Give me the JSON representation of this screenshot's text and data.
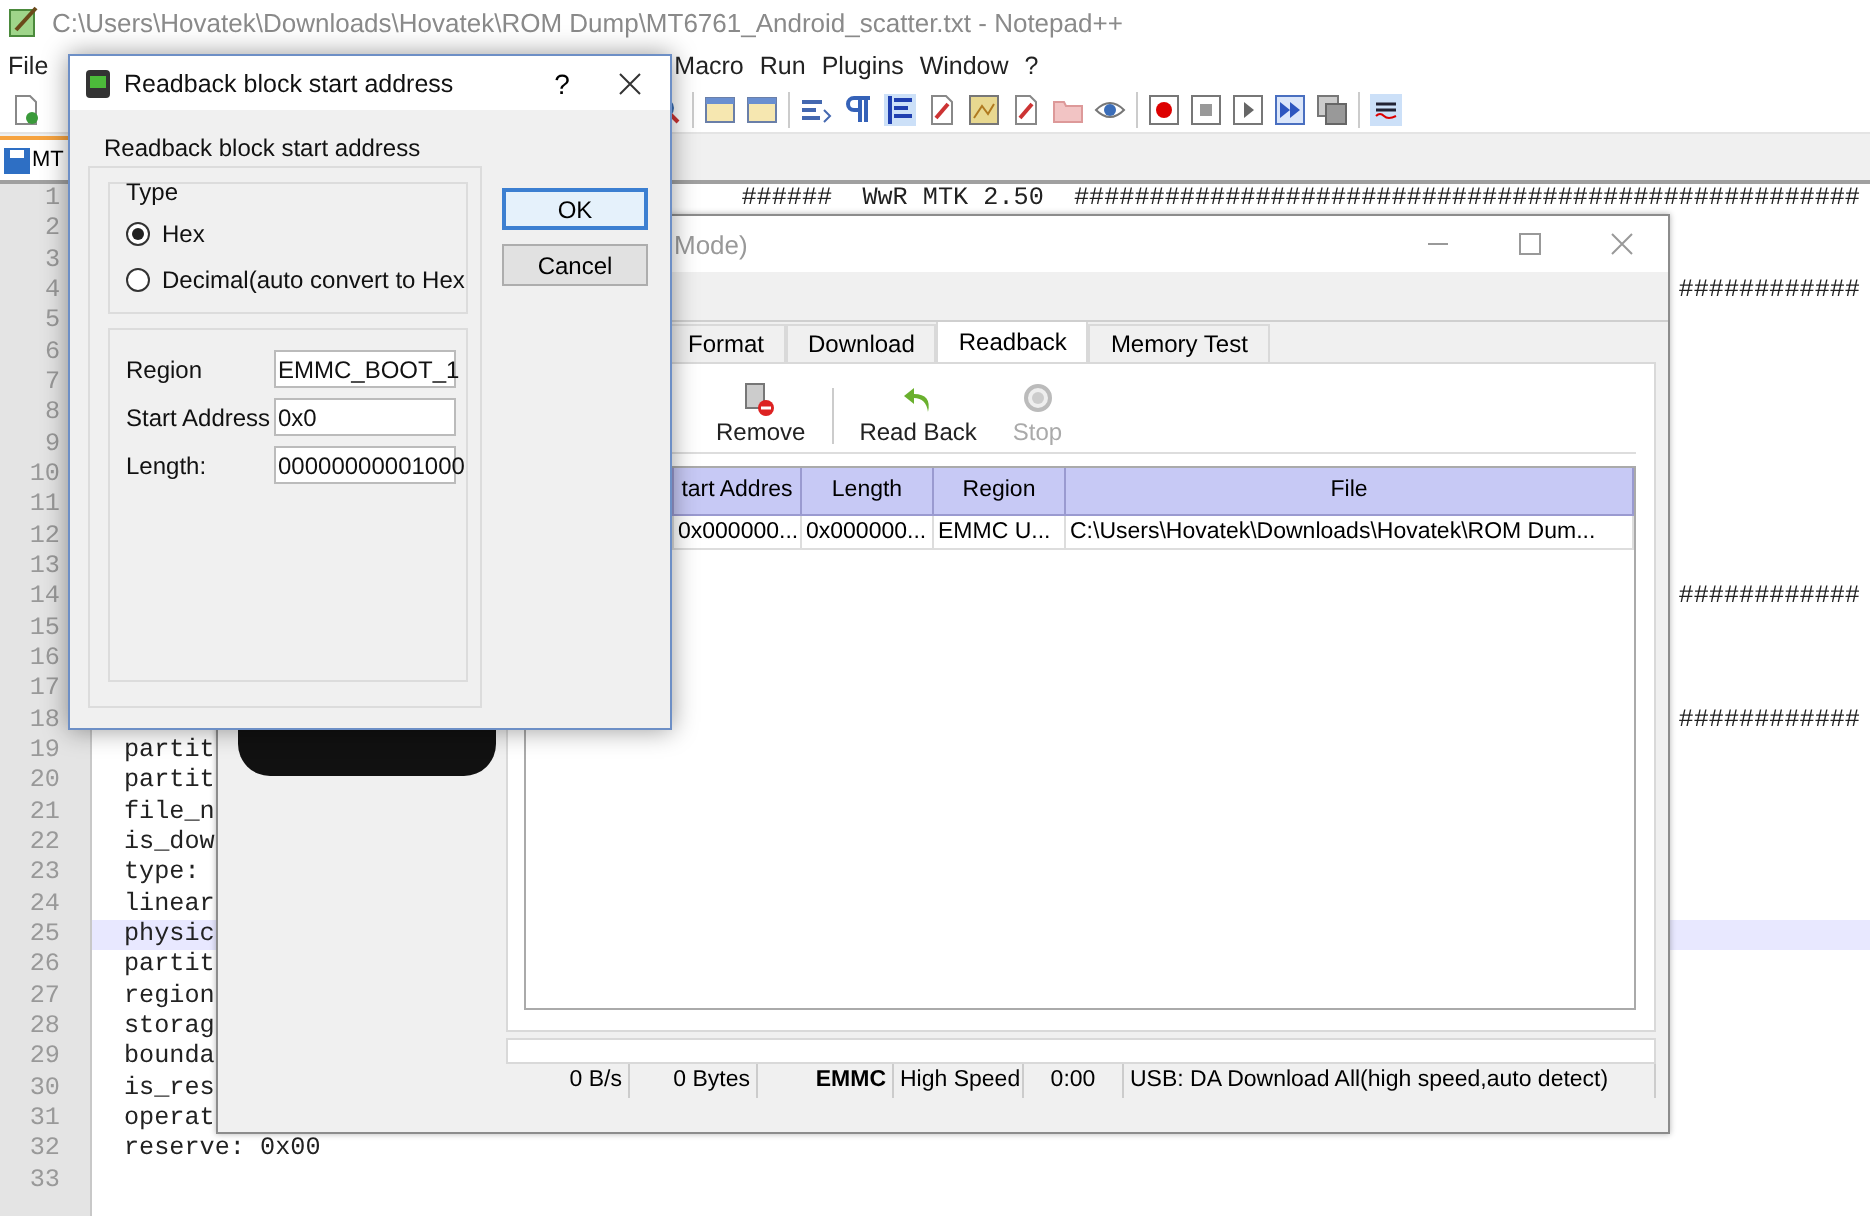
{
  "notepad": {
    "title": "C:\\Users\\Hovatek\\Downloads\\Hovatek\\ROM Dump\\MT6761_Android_scatter.txt - Notepad++",
    "menu": [
      "File",
      "Macro",
      "Run",
      "Plugins",
      "Window",
      "?"
    ],
    "tab": "MT",
    "lines": [
      {
        "number": "1",
        "current": false,
        "tail": "######  WwR MTK 2.50  ####################################################"
      },
      {
        "number": "2",
        "current": false
      },
      {
        "number": "3",
        "current": false
      },
      {
        "number": "4",
        "current": false,
        "tail": "############"
      },
      {
        "number": "5",
        "current": false
      },
      {
        "number": "6",
        "current": false
      },
      {
        "number": "7",
        "current": false
      },
      {
        "number": "8",
        "current": false
      },
      {
        "number": "9",
        "current": false
      },
      {
        "number": "10",
        "current": false
      },
      {
        "number": "11",
        "current": false
      },
      {
        "number": "12",
        "current": false
      },
      {
        "number": "13",
        "current": false
      },
      {
        "number": "14",
        "current": false,
        "tail": "############"
      },
      {
        "number": "15",
        "current": false
      },
      {
        "number": "16",
        "current": false
      },
      {
        "number": "17",
        "current": false
      },
      {
        "number": "18",
        "current": false,
        "tail": "############"
      },
      {
        "number": "19",
        "current": false,
        "text": "partit"
      },
      {
        "number": "20",
        "current": false,
        "text": "partit"
      },
      {
        "number": "21",
        "current": false,
        "text": "file_n"
      },
      {
        "number": "22",
        "current": false,
        "text": "is_dow"
      },
      {
        "number": "23",
        "current": false,
        "text": "type:"
      },
      {
        "number": "24",
        "current": false,
        "text": "linear"
      },
      {
        "number": "25",
        "current": true,
        "text": "physic"
      },
      {
        "number": "26",
        "current": false,
        "text": "partit"
      },
      {
        "number": "27",
        "current": false,
        "text": "region"
      },
      {
        "number": "28",
        "current": false,
        "text": "storag"
      },
      {
        "number": "29",
        "current": false,
        "text": "bounda"
      },
      {
        "number": "30",
        "current": false,
        "text": "is_res"
      },
      {
        "number": "31",
        "current": false,
        "text": "operat"
      },
      {
        "number": "32",
        "current": false,
        "text": "reserve: 0x00"
      },
      {
        "number": "33",
        "current": false
      }
    ]
  },
  "flash_tool": {
    "title": "Mode)",
    "tabs": [
      {
        "label": "Format",
        "selected": false
      },
      {
        "label": "Download",
        "selected": false
      },
      {
        "label": "Readback",
        "selected": true
      },
      {
        "label": "Memory Test",
        "selected": false
      }
    ],
    "toolbar": [
      {
        "kind": "remove",
        "label": "Remove",
        "disabled": false
      },
      {
        "kind": "read_back",
        "label": "Read Back",
        "disabled": false
      },
      {
        "kind": "stop",
        "label": "Stop",
        "disabled": true
      }
    ],
    "table": {
      "columns": [
        "tart Addres",
        "Length",
        "Region",
        "File"
      ],
      "rows": [
        [
          "0x000000...",
          "0x000000...",
          "EMMC U...",
          "C:\\Users\\Hovatek\\Downloads\\Hovatek\\ROM Dum..."
        ]
      ]
    },
    "progress": {
      "level": 0
    },
    "status_bar": {
      "speed": "0 B/s",
      "bytes": "0 Bytes",
      "storage": "EMMC",
      "mode": "High Speed",
      "time": "0:00",
      "connection": "USB: DA Download All(high speed,auto detect)"
    }
  },
  "dialog": {
    "title": "Readback block start address",
    "help": "?",
    "group_title": "Readback block start address",
    "type_group": "Type",
    "type_options": [
      {
        "label": "Hex",
        "selected": true
      },
      {
        "label": "Decimal(auto convert to Hex",
        "selected": false
      }
    ],
    "fields": [
      {
        "kind": "dropdown",
        "label": "Region",
        "value": "EMMC_BOOT_1"
      },
      {
        "kind": "text",
        "label": "Start Address",
        "value": "0x0"
      },
      {
        "kind": "text",
        "label": "Length:",
        "value": "00000000001000"
      }
    ],
    "buttons": [
      {
        "label": "OK",
        "default": true
      },
      {
        "label": "Cancel",
        "default": false
      }
    ]
  }
}
